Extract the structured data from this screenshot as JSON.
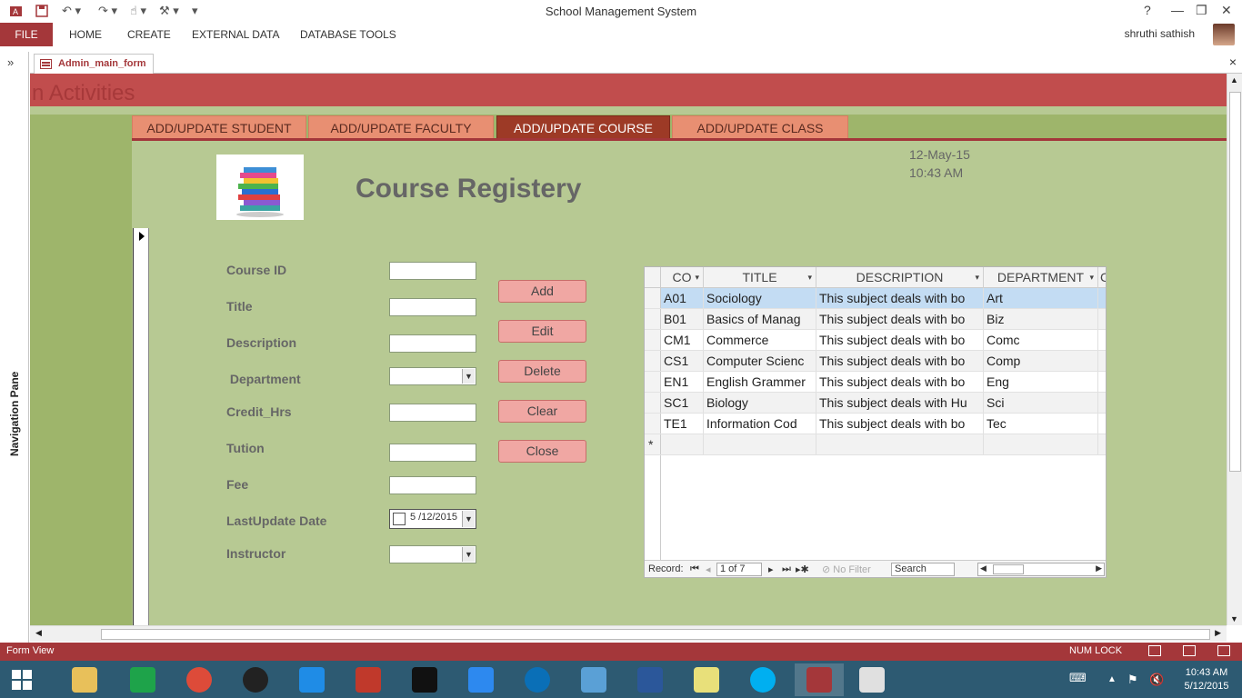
{
  "app": {
    "title": "School Management System",
    "user": "shruthi sathish"
  },
  "ribbon": {
    "file": "FILE",
    "tabs": [
      "HOME",
      "CREATE",
      "EXTERNAL DATA",
      "DATABASE TOOLS"
    ],
    "help": "?"
  },
  "nav_pane": {
    "label": "Navigation Pane",
    "toggle": "»"
  },
  "document": {
    "tab_label": "Admin_main_form",
    "close": "×"
  },
  "form": {
    "header_title": "n Activities",
    "tabs": [
      {
        "label": "ADD/UPDATE STUDENT",
        "active": false
      },
      {
        "label": "ADD/UPDATE FACULTY",
        "active": false
      },
      {
        "label": "ADD/UPDATE COURSE",
        "active": true
      },
      {
        "label": "ADD/UPDATE CLASS",
        "active": false
      }
    ],
    "date": "12-May-15",
    "time": "10:43 AM",
    "heading": "Course Registery",
    "fields": {
      "course_id": "Course ID",
      "title": "Title",
      "description": "Description",
      "department": " Department",
      "credit_hrs": "Credit_Hrs",
      "tution": "Tution",
      "fee": "Fee",
      "last_update": "LastUpdate Date",
      "instructor": "Instructor"
    },
    "last_update_value": "5 /12/2015",
    "buttons": {
      "add": "Add",
      "edit": "Edit",
      "delete": "Delete",
      "clear": "Clear",
      "close": "Close"
    }
  },
  "grid": {
    "columns": [
      "CO",
      "TITLE",
      "DESCRIPTION",
      "DEPARTMENT",
      "C"
    ],
    "rows": [
      [
        "A01",
        "Sociology",
        "This subject deals with bo",
        "Art"
      ],
      [
        "B01",
        "Basics of Manag",
        "This subject deals with bo",
        "Biz"
      ],
      [
        "CM1",
        "Commerce",
        "This subject deals with bo",
        "Comc"
      ],
      [
        "CS1",
        "Computer Scienc",
        "This subject deals with bo",
        "Comp"
      ],
      [
        "EN1",
        "English Grammer",
        "This subject deals with bo",
        "Eng"
      ],
      [
        "SC1",
        "Biology",
        "This subject deals with Hu",
        "Sci"
      ],
      [
        "TE1",
        "Information Cod",
        "This subject deals with bo",
        "Tec"
      ]
    ],
    "new_row_marker": "*",
    "nav": {
      "record_label": "Record:",
      "position": "1 of 7",
      "filter": "No Filter",
      "search": "Search"
    }
  },
  "status": {
    "left": "Form View",
    "num_lock": "NUM LOCK"
  },
  "taskbar": {
    "clock_time": "10:43 AM",
    "clock_date": "5/12/2015",
    "apps": [
      "file-explorer",
      "store",
      "chrome",
      "media",
      "internet-explorer",
      "puzzle",
      "amazon",
      "onedrive",
      "hp",
      "network",
      "visio",
      "sticky-notes",
      "skype",
      "access",
      "paint"
    ]
  },
  "colors": {
    "accent": "#a4373a",
    "form_bg": "#b7c993",
    "tab": "#e88f72",
    "tab_active": "#9d3a26",
    "button": "#f0a7a3"
  }
}
